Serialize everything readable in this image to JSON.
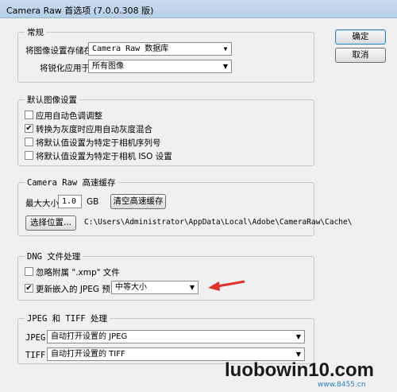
{
  "window": {
    "title": "Camera Raw 首选项 (7.0.0.308 版)"
  },
  "buttons": {
    "ok": "确定",
    "cancel": "取消"
  },
  "general": {
    "legend": "常规",
    "save_settings_label": "将图像设置存储在:",
    "save_settings_value": "Camera Raw 数据库",
    "sharpen_label": "将锐化应用于:",
    "sharpen_value": "所有图像"
  },
  "default_image": {
    "legend": "默认图像设置",
    "options": [
      {
        "label": "应用自动色调调整",
        "checked": false
      },
      {
        "label": "转换为灰度时应用自动灰度混合",
        "checked": true
      },
      {
        "label": "将默认值设置为特定于相机序列号",
        "checked": false
      },
      {
        "label": "将默认值设置为特定于相机 ISO 设置",
        "checked": false
      }
    ]
  },
  "cache": {
    "legend": "Camera Raw 高速缓存",
    "max_size_label": "最大大小:",
    "max_size_value": "1.0",
    "unit": "GB",
    "purge_button": "清空高速缓存",
    "choose_button": "选择位置...",
    "path": "C:\\Users\\Administrator\\AppData\\Local\\Adobe\\CameraRaw\\Cache\\"
  },
  "dng": {
    "legend": "DNG 文件处理",
    "ignore_label": "忽略附属 \".xmp\" 文件",
    "ignore_checked": false,
    "update_label": "更新嵌入的 JPEG 预览:",
    "update_checked": true,
    "preview_value": "中等大小"
  },
  "jpeg_tiff": {
    "legend": "JPEG 和 TIFF 处理",
    "jpeg_label": "JPEG:",
    "jpeg_value": "自动打开设置的 JPEG",
    "tiff_label": "TIFF:",
    "tiff_value": "自动打开设置的 TIFF"
  },
  "watermark": {
    "text": "luobowin10.com",
    "site": "www.8455.cn"
  },
  "colors": {
    "annotation_arrow": "#e0322a",
    "default_button_border": "#3c7fb1"
  }
}
